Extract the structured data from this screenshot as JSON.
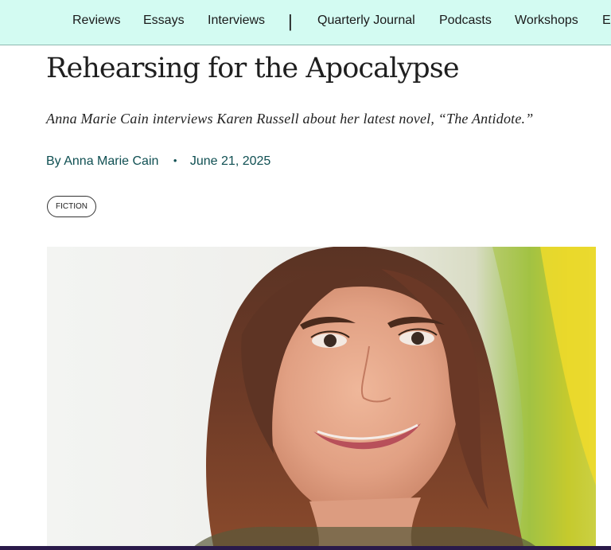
{
  "nav": {
    "items": [
      "Reviews",
      "Essays",
      "Interviews",
      "Quarterly Journal",
      "Podcasts",
      "Workshops",
      "E"
    ],
    "separator": "|"
  },
  "article": {
    "title": "Rehearsing for the Apocalypse",
    "dek": "Anna Marie Cain interviews Karen Russell about her latest novel, “The Antidote.”",
    "byline_prefix": "By",
    "author": "Anna Marie Cain",
    "dot": "•",
    "date": "June 21, 2025",
    "tag": "FICTION"
  },
  "colors": {
    "nav_background": "#d3fbf2",
    "byline_color": "#0f4f52",
    "bottom_bar": "#2a1a4a"
  }
}
